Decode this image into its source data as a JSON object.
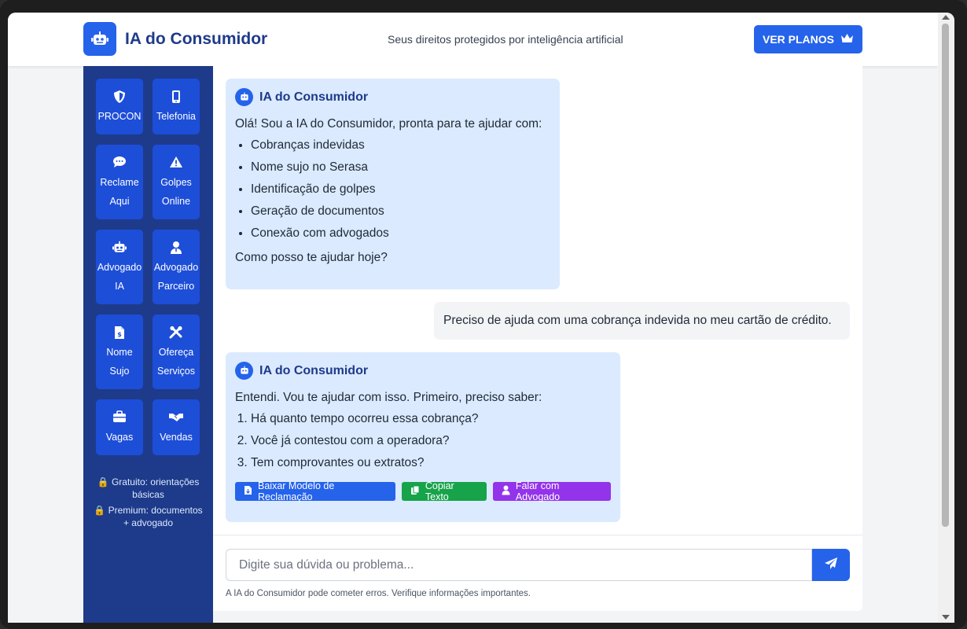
{
  "header": {
    "brand": "IA do Consumidor",
    "tagline": "Seus direitos protegidos por inteligência artificial",
    "plans_button": "VER PLANOS"
  },
  "sidebar": {
    "items": [
      {
        "line1": "PROCON",
        "line2": "",
        "icon": "shield-icon"
      },
      {
        "line1": "Telefonia",
        "line2": "",
        "icon": "phone-icon"
      },
      {
        "line1": "Reclame",
        "line2": "Aqui",
        "icon": "comment-icon"
      },
      {
        "line1": "Golpes",
        "line2": "Online",
        "icon": "warning-icon"
      },
      {
        "line1": "Advogado",
        "line2": "IA",
        "icon": "robot-icon"
      },
      {
        "line1": "Advogado",
        "line2": "Parceiro",
        "icon": "user-tie-icon"
      },
      {
        "line1": "Nome",
        "line2": "Sujo",
        "icon": "invoice-icon"
      },
      {
        "line1": "Ofereça",
        "line2": "Serviços",
        "icon": "tools-icon"
      },
      {
        "line1": "Vagas",
        "line2": "",
        "icon": "briefcase-icon"
      },
      {
        "line1": "Vendas",
        "line2": "",
        "icon": "handshake-icon"
      }
    ],
    "note_free": "Gratuito: orientações básicas",
    "note_premium": "Premium: documentos + advogado"
  },
  "chat": {
    "messages": [
      {
        "role": "ai",
        "name": "IA do Consumidor",
        "intro": "Olá! Sou a IA do Consumidor, pronta para te ajudar com:",
        "bullets": [
          "Cobranças indevidas",
          "Nome sujo no Serasa",
          "Identificação de golpes",
          "Geração de documentos",
          "Conexão com advogados"
        ],
        "outro": "Como posso te ajudar hoje?"
      },
      {
        "role": "user",
        "text": "Preciso de ajuda com uma cobrança indevida no meu cartão de crédito."
      },
      {
        "role": "ai",
        "name": "IA do Consumidor",
        "intro": "Entendi. Vou te ajudar com isso. Primeiro, preciso saber:",
        "numbered": [
          "Há quanto tempo ocorreu essa cobrança?",
          "Você já contestou com a operadora?",
          "Tem comprovantes ou extratos?"
        ],
        "actions": [
          {
            "label": "Baixar Modelo de Reclamação",
            "icon": "file-download-icon",
            "color": "#2563eb"
          },
          {
            "label": "Copiar Texto",
            "icon": "copy-icon",
            "color": "#16a34a"
          },
          {
            "label": "Falar com Advogado",
            "icon": "user-icon",
            "color": "#9333ea"
          }
        ]
      }
    ],
    "input_placeholder": "Digite sua dúvida ou problema...",
    "disclaimer": "A IA do Consumidor pode cometer erros. Verifique informações importantes."
  },
  "colors": {
    "primary": "#2563eb",
    "sidebar_bg": "#1e3a8a",
    "sidebar_item": "#1d4ed8",
    "ai_bubble": "#dbeafe",
    "user_bubble": "#f3f4f6"
  }
}
